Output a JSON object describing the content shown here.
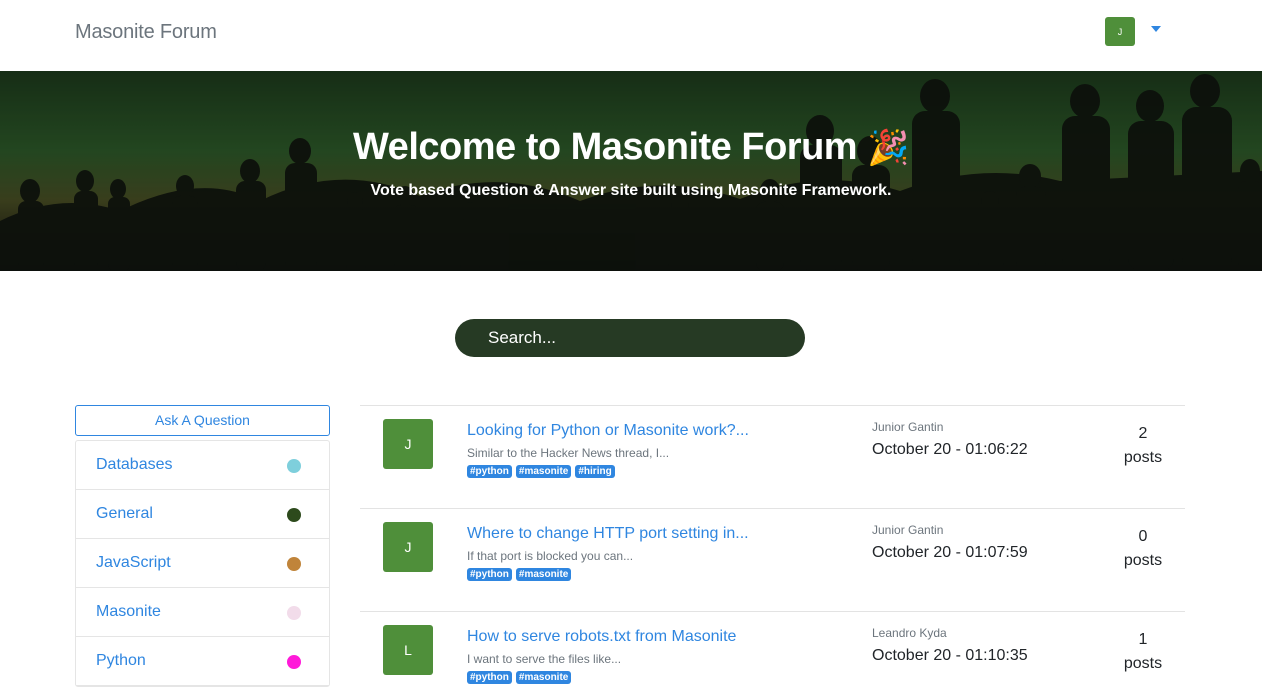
{
  "navbar": {
    "brand": "Masonite Forum",
    "avatar_initial": "J",
    "caret_icon": "caret-down-icon"
  },
  "hero": {
    "title": "Welcome to Masonite Forum",
    "emoji": "🎉",
    "subtitle": "Vote based Question & Answer site built using Masonite Framework."
  },
  "search": {
    "placeholder": "Search..."
  },
  "sidebar": {
    "ask_button": "Ask A Question",
    "categories": [
      {
        "label": "Databases",
        "color": "#7ecfdc"
      },
      {
        "label": "General",
        "color": "#2d4a1c"
      },
      {
        "label": "JavaScript",
        "color": "#c0843a"
      },
      {
        "label": "Masonite",
        "color": "#f2dcea"
      },
      {
        "label": "Python",
        "color": "#ff1ad9"
      }
    ]
  },
  "questions": [
    {
      "avatar": "J",
      "title": "Looking for Python or Masonite work?...",
      "snippet": "Similar to the Hacker News thread, I...",
      "tags": [
        "#python",
        "#masonite",
        "#hiring"
      ],
      "author": "Junior Gantin",
      "date": "October 20 - 01:06:22",
      "count": "2",
      "count_label": "posts"
    },
    {
      "avatar": "J",
      "title": "Where to change HTTP port setting in...",
      "snippet": "If that port is blocked you can...",
      "tags": [
        "#python",
        "#masonite"
      ],
      "author": "Junior Gantin",
      "date": "October 20 - 01:07:59",
      "count": "0",
      "count_label": "posts"
    },
    {
      "avatar": "L",
      "title": "How to serve robots.txt from Masonite",
      "snippet": "I want to serve the files like...",
      "tags": [
        "#python",
        "#masonite"
      ],
      "author": "Leandro Kyda",
      "date": "October 20 - 01:10:35",
      "count": "1",
      "count_label": "posts"
    }
  ],
  "colors": {
    "accent": "#2f86e0",
    "avatar_bg": "#4f8f3a",
    "search_bg": "#263a24"
  }
}
